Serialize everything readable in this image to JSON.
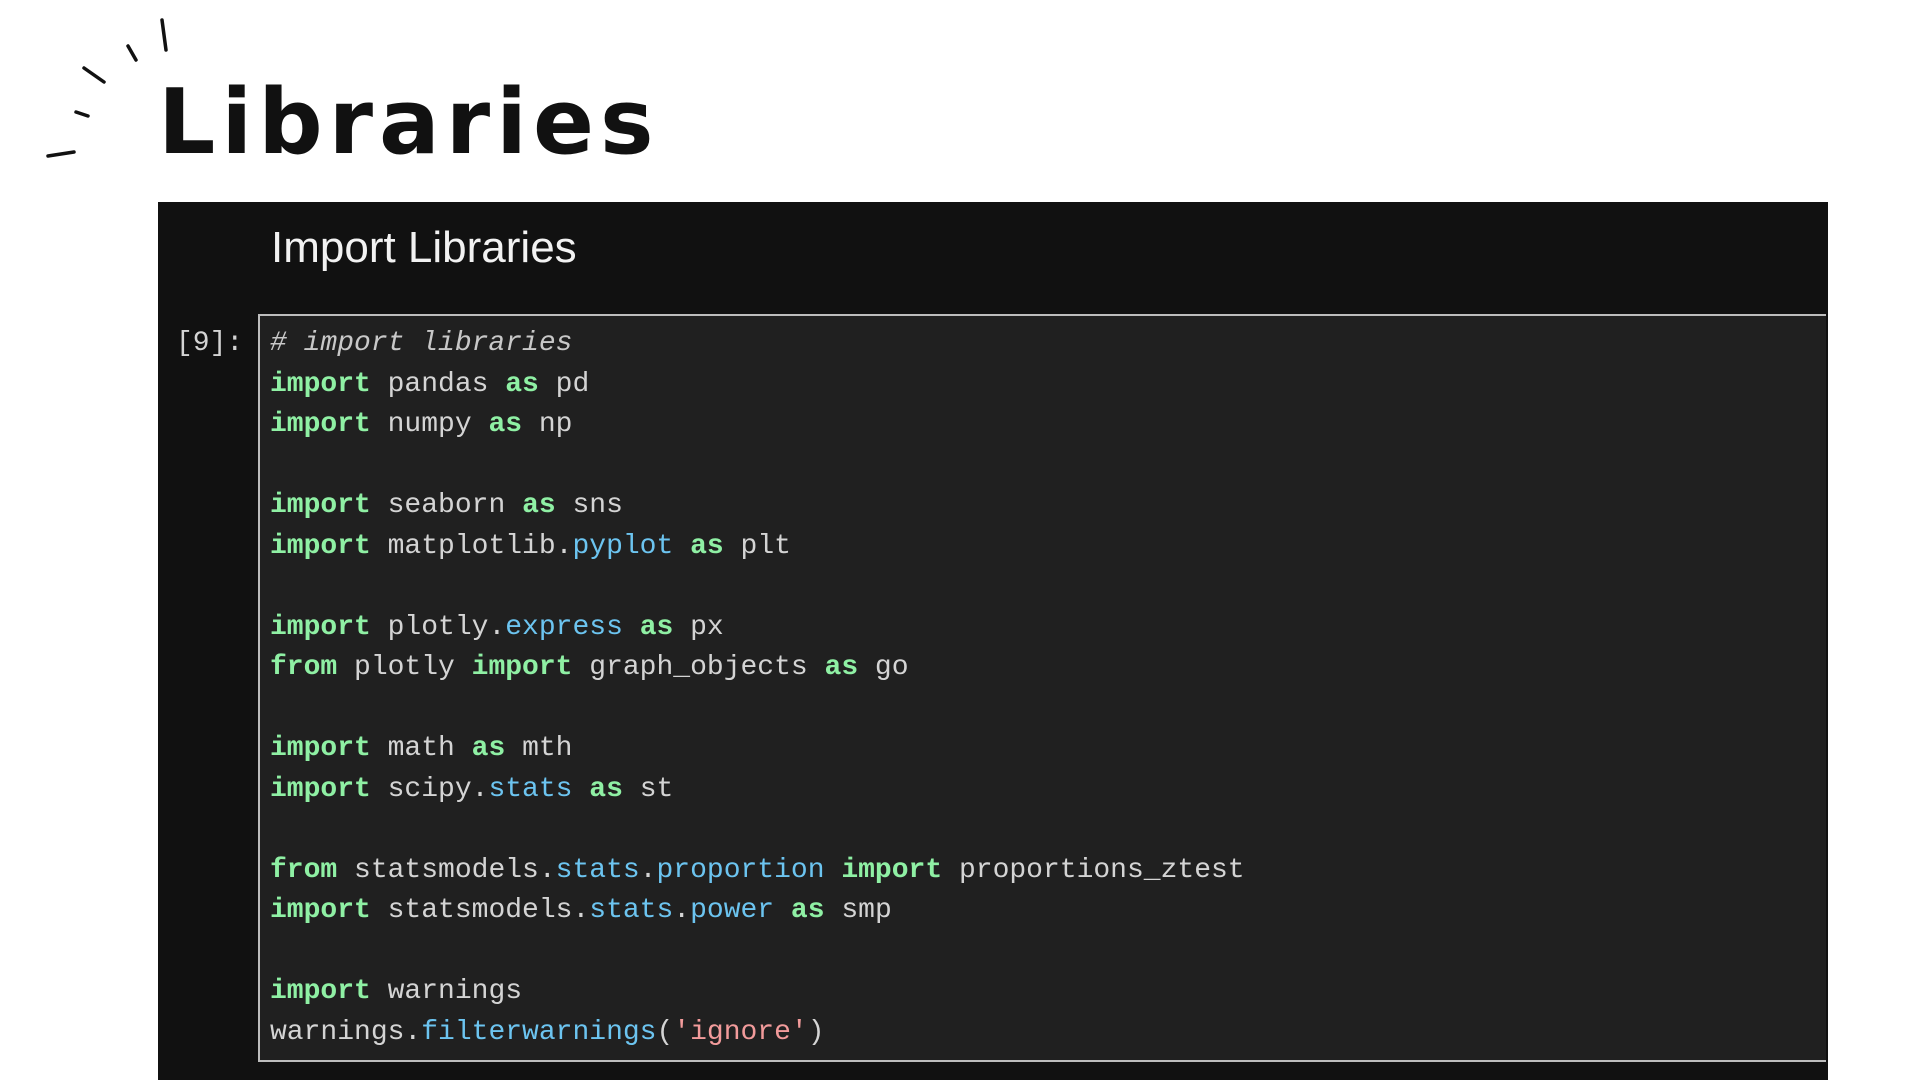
{
  "page": {
    "title": "Libraries"
  },
  "notebook": {
    "heading": "Import Libraries",
    "prompt": "[9]:",
    "code": [
      [
        {
          "t": "cm",
          "v": "# import libraries"
        }
      ],
      [
        {
          "t": "kw",
          "v": "import"
        },
        {
          "t": "id",
          "v": " pandas "
        },
        {
          "t": "kw",
          "v": "as"
        },
        {
          "t": "id",
          "v": " pd"
        }
      ],
      [
        {
          "t": "kw",
          "v": "import"
        },
        {
          "t": "id",
          "v": " numpy "
        },
        {
          "t": "kw",
          "v": "as"
        },
        {
          "t": "id",
          "v": " np"
        }
      ],
      [],
      [
        {
          "t": "kw",
          "v": "import"
        },
        {
          "t": "id",
          "v": " seaborn "
        },
        {
          "t": "kw",
          "v": "as"
        },
        {
          "t": "id",
          "v": " sns"
        }
      ],
      [
        {
          "t": "kw",
          "v": "import"
        },
        {
          "t": "id",
          "v": " matplotlib."
        },
        {
          "t": "attr",
          "v": "pyplot"
        },
        {
          "t": "id",
          "v": " "
        },
        {
          "t": "kw",
          "v": "as"
        },
        {
          "t": "id",
          "v": " plt"
        }
      ],
      [],
      [
        {
          "t": "kw",
          "v": "import"
        },
        {
          "t": "id",
          "v": " plotly."
        },
        {
          "t": "attr",
          "v": "express"
        },
        {
          "t": "id",
          "v": " "
        },
        {
          "t": "kw",
          "v": "as"
        },
        {
          "t": "id",
          "v": " px"
        }
      ],
      [
        {
          "t": "kw",
          "v": "from"
        },
        {
          "t": "id",
          "v": " plotly "
        },
        {
          "t": "kw",
          "v": "import"
        },
        {
          "t": "id",
          "v": " graph_objects "
        },
        {
          "t": "kw",
          "v": "as"
        },
        {
          "t": "id",
          "v": " go"
        }
      ],
      [],
      [
        {
          "t": "kw",
          "v": "import"
        },
        {
          "t": "id",
          "v": " math "
        },
        {
          "t": "kw",
          "v": "as"
        },
        {
          "t": "id",
          "v": " mth"
        }
      ],
      [
        {
          "t": "kw",
          "v": "import"
        },
        {
          "t": "id",
          "v": " scipy."
        },
        {
          "t": "attr",
          "v": "stats"
        },
        {
          "t": "id",
          "v": " "
        },
        {
          "t": "kw",
          "v": "as"
        },
        {
          "t": "id",
          "v": " st"
        }
      ],
      [],
      [
        {
          "t": "kw",
          "v": "from"
        },
        {
          "t": "id",
          "v": " statsmodels."
        },
        {
          "t": "attr",
          "v": "stats"
        },
        {
          "t": "id",
          "v": "."
        },
        {
          "t": "attr",
          "v": "proportion"
        },
        {
          "t": "id",
          "v": " "
        },
        {
          "t": "kw",
          "v": "import"
        },
        {
          "t": "id",
          "v": " proportions_ztest"
        }
      ],
      [
        {
          "t": "kw",
          "v": "import"
        },
        {
          "t": "id",
          "v": " statsmodels."
        },
        {
          "t": "attr",
          "v": "stats"
        },
        {
          "t": "id",
          "v": "."
        },
        {
          "t": "attr",
          "v": "power"
        },
        {
          "t": "id",
          "v": " "
        },
        {
          "t": "kw",
          "v": "as"
        },
        {
          "t": "id",
          "v": " smp"
        }
      ],
      [],
      [
        {
          "t": "kw",
          "v": "import"
        },
        {
          "t": "id",
          "v": " warnings"
        }
      ],
      [
        {
          "t": "id",
          "v": "warnings."
        },
        {
          "t": "attr",
          "v": "filterwarnings"
        },
        {
          "t": "id",
          "v": "("
        },
        {
          "t": "str",
          "v": "'ignore'"
        },
        {
          "t": "id",
          "v": ")"
        }
      ]
    ]
  },
  "colors": {
    "keyword": "#8ff0a4",
    "attribute": "#6cc4f0",
    "string": "#f29b9b",
    "panel_bg": "#111111",
    "cell_bg": "#202020"
  },
  "icons": {
    "sparkle": "sparkle-lines-icon"
  }
}
